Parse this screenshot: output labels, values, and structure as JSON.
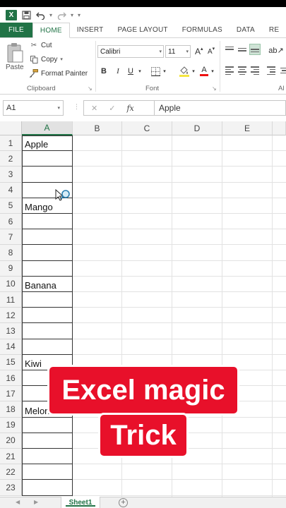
{
  "quick_access": {
    "app_logo": "X",
    "icons": [
      "save-icon",
      "undo-icon",
      "redo-icon",
      "customize-icon"
    ]
  },
  "tabs": [
    "FILE",
    "HOME",
    "INSERT",
    "PAGE LAYOUT",
    "FORMULAS",
    "DATA",
    "RE"
  ],
  "active_tab": "HOME",
  "ribbon": {
    "clipboard": {
      "paste_label": "Paste",
      "cut_label": "Cut",
      "copy_label": "Copy",
      "format_painter_label": "Format Painter",
      "group_label": "Clipboard"
    },
    "font": {
      "font_name": "Calibri",
      "font_size": "11",
      "grow_label": "A",
      "shrink_label": "A",
      "bold_label": "B",
      "italic_label": "I",
      "underline_label": "U",
      "font_color_label": "A",
      "group_label": "Font"
    },
    "alignment": {
      "group_label": "Al"
    }
  },
  "formula_bar": {
    "name_box": "A1",
    "cancel_symbol": "✕",
    "enter_symbol": "✓",
    "fx_label": "fx",
    "formula": "Apple"
  },
  "grid": {
    "columns": [
      "A",
      "B",
      "C",
      "D",
      "E"
    ],
    "selected_column": "A",
    "rows": [
      "1",
      "2",
      "3",
      "4",
      "5",
      "6",
      "7",
      "8",
      "9",
      "10",
      "11",
      "12",
      "13",
      "14",
      "15",
      "16",
      "17",
      "18",
      "19",
      "20",
      "21",
      "22",
      "23"
    ],
    "cells_A": [
      "Apple",
      "",
      "",
      "",
      "Mango",
      "",
      "",
      "",
      "",
      "Banana",
      "",
      "",
      "",
      "",
      "Kiwi",
      "",
      "",
      "Melon",
      "",
      "",
      "",
      "",
      ""
    ]
  },
  "sheets": {
    "tabs": [
      "Sheet1"
    ],
    "add_symbol": "+"
  },
  "overlay": {
    "line1": "Excel magic",
    "line2": "Trick"
  },
  "colors": {
    "excel_green": "#217346",
    "overlay_red": "#e8102a"
  }
}
